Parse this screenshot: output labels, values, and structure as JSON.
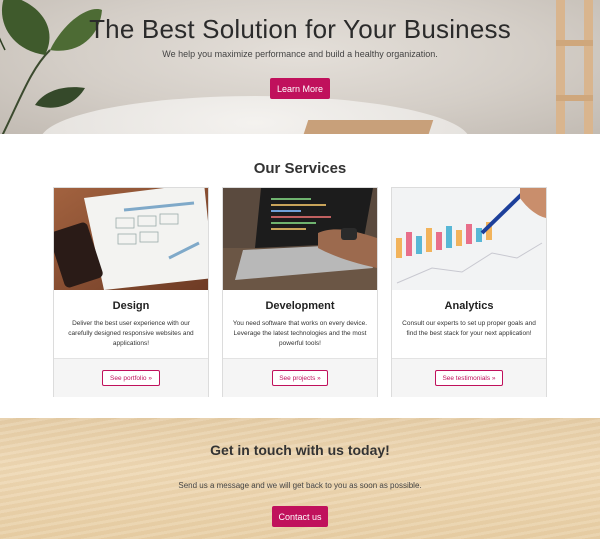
{
  "hero": {
    "title": "The Best Solution for Your Business",
    "subtitle": "We help you maximize performance and build a healthy organization.",
    "button_label": "Learn More"
  },
  "services": {
    "title": "Our Services",
    "cards": [
      {
        "title": "Design",
        "text": "Deliver the best user experience with our carefully designed responsive websites and applications!",
        "button_label": "See portfolio »"
      },
      {
        "title": "Development",
        "text": "You need software that works on every device. Leverage the latest technologies and the most powerful tools!",
        "button_label": "See projects »"
      },
      {
        "title": "Analytics",
        "text": "Consult our experts to set up proper goals and find the best stack for your next application!",
        "button_label": "See testimonials »"
      }
    ]
  },
  "contact": {
    "title": "Get in touch with us today!",
    "subtitle": "Send us a message and we will get back to you as soon as possible.",
    "button_label": "Contact us"
  },
  "colors": {
    "accent": "#c0115c",
    "footer_bg": "#f5f5f5"
  }
}
